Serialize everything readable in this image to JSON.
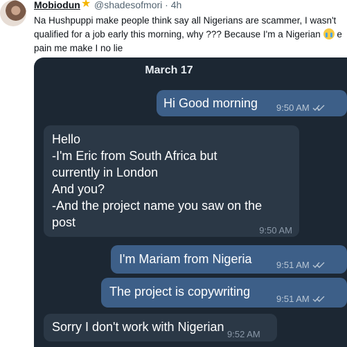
{
  "tweet": {
    "author_name": "Mobiodun",
    "author_handle": "@shadesofmori",
    "separator": "·",
    "time_ago": "4h",
    "text_part1": "Na Hushpuppi make people think say all Nigerians are scammer, I wasn't qualified for a job early this morning, why ??? Because I'm a Nigerian",
    "text_part2": "e pain me make I no lie",
    "emoji_icon": "crying-face-icon",
    "badge_icon": "star-icon",
    "badge_color": "#f4b400"
  },
  "chat": {
    "date_header": "March 17",
    "colors": {
      "background": "#1c2733",
      "outgoing": "#3d5f88",
      "incoming": "#2b3846"
    },
    "messages": [
      {
        "direction": "outgoing",
        "text": "Hi Good morning",
        "time": "9:50 AM",
        "read_icon": "double-check-icon"
      },
      {
        "direction": "incoming",
        "text": "Hello\n-I'm Eric from South Africa but\ncurrently in London\nAnd you?\n-And the project name you saw on the\npost",
        "time": "9:50 AM"
      },
      {
        "direction": "outgoing",
        "text": "I'm Mariam from Nigeria",
        "time": "9:51 AM",
        "read_icon": "double-check-icon"
      },
      {
        "direction": "outgoing",
        "text": "The project is copywriting",
        "time": "9:51 AM",
        "read_icon": "double-check-icon"
      },
      {
        "direction": "incoming",
        "text": "Sorry I don't work with Nigerian",
        "time": "9:52 AM"
      }
    ]
  }
}
